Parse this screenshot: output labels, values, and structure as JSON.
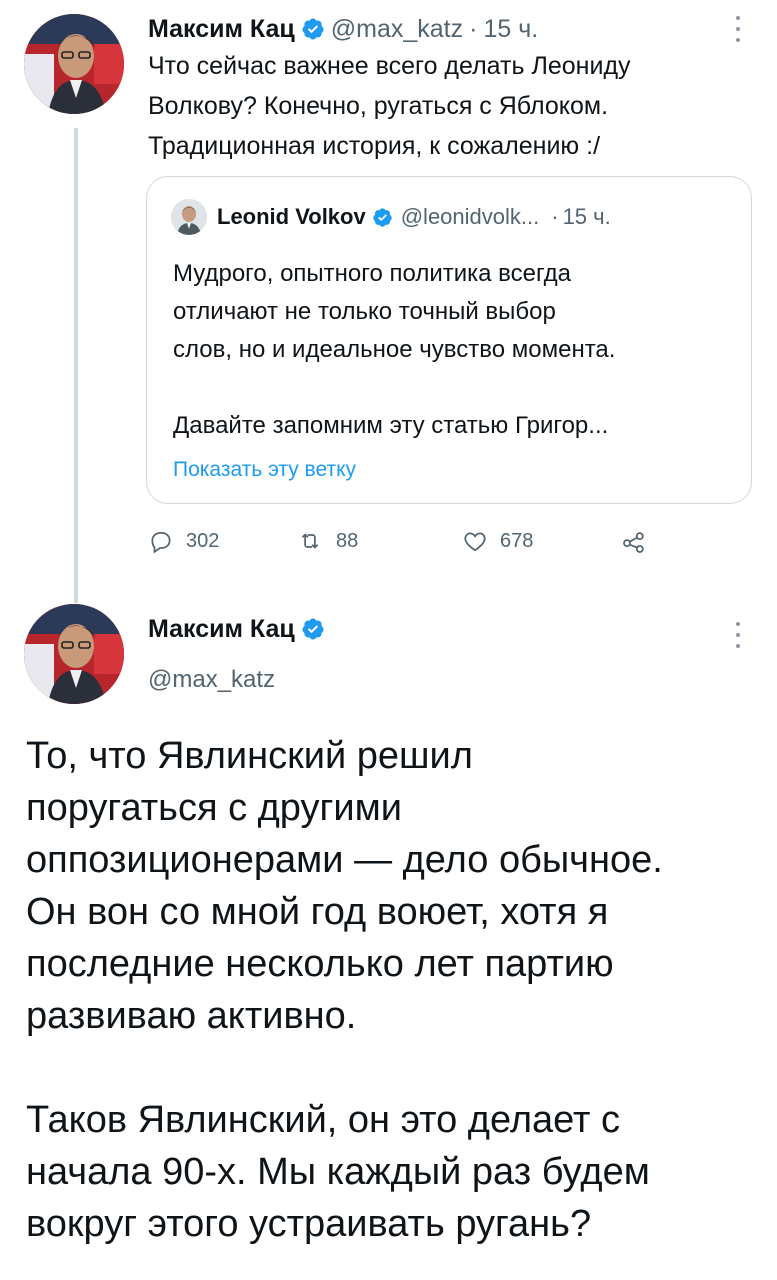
{
  "tweet1": {
    "author_name": "Максим Кац",
    "handle": "@max_katz",
    "separator": "·",
    "time": "15 ч.",
    "text": "Что сейчас важнее всего делать Леониду\nВолкову? Конечно, ругаться с Яблоком.\nТрадиционная история, к сожалению :/",
    "quote": {
      "author_name": "Leonid Volkov",
      "handle": "@leonidvolk...",
      "separator": "·",
      "time": "15 ч.",
      "text": "Мудрого, опытного политика всегда\nотличают не только точный выбор\nслов, но и идеальное чувство момента.\n\nДавайте запомним эту статью Григор...",
      "show_thread": "Показать эту ветку"
    },
    "actions": {
      "replies": "302",
      "retweets": "88",
      "likes": "678"
    }
  },
  "tweet2": {
    "author_name": "Максим Кац",
    "handle": "@max_katz",
    "text": "То, что Явлинский решил\nпоругаться с другими\nоппозиционерами — дело обычное.\nОн вон со мной год воюет, хотя я\nпоследние несколько лет партию\nразвиваю активно.\n\nТаков Явлинский, он это делает с\nначала 90-х. Мы каждый раз будем\nвокруг этого устраивать ругань?"
  },
  "colors": {
    "text": "#0f1419",
    "secondary": "#536471",
    "accent": "#1d9bf0",
    "border": "#cfd9de"
  },
  "icons": [
    "verified-badge-icon",
    "more-options-icon",
    "reply-icon",
    "retweet-icon",
    "like-icon",
    "share-icon"
  ]
}
